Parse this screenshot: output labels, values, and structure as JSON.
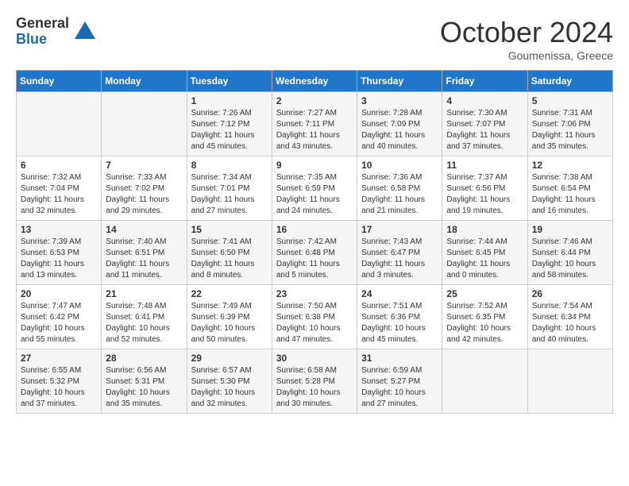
{
  "logo": {
    "general": "General",
    "blue": "Blue"
  },
  "title": "October 2024",
  "location": "Goumenissa, Greece",
  "days_of_week": [
    "Sunday",
    "Monday",
    "Tuesday",
    "Wednesday",
    "Thursday",
    "Friday",
    "Saturday"
  ],
  "weeks": [
    [
      {
        "day": "",
        "info": ""
      },
      {
        "day": "",
        "info": ""
      },
      {
        "day": "1",
        "info": "Sunrise: 7:26 AM\nSunset: 7:12 PM\nDaylight: 11 hours and 45 minutes."
      },
      {
        "day": "2",
        "info": "Sunrise: 7:27 AM\nSunset: 7:11 PM\nDaylight: 11 hours and 43 minutes."
      },
      {
        "day": "3",
        "info": "Sunrise: 7:28 AM\nSunset: 7:09 PM\nDaylight: 11 hours and 40 minutes."
      },
      {
        "day": "4",
        "info": "Sunrise: 7:30 AM\nSunset: 7:07 PM\nDaylight: 11 hours and 37 minutes."
      },
      {
        "day": "5",
        "info": "Sunrise: 7:31 AM\nSunset: 7:06 PM\nDaylight: 11 hours and 35 minutes."
      }
    ],
    [
      {
        "day": "6",
        "info": "Sunrise: 7:32 AM\nSunset: 7:04 PM\nDaylight: 11 hours and 32 minutes."
      },
      {
        "day": "7",
        "info": "Sunrise: 7:33 AM\nSunset: 7:02 PM\nDaylight: 11 hours and 29 minutes."
      },
      {
        "day": "8",
        "info": "Sunrise: 7:34 AM\nSunset: 7:01 PM\nDaylight: 11 hours and 27 minutes."
      },
      {
        "day": "9",
        "info": "Sunrise: 7:35 AM\nSunset: 6:59 PM\nDaylight: 11 hours and 24 minutes."
      },
      {
        "day": "10",
        "info": "Sunrise: 7:36 AM\nSunset: 6:58 PM\nDaylight: 11 hours and 21 minutes."
      },
      {
        "day": "11",
        "info": "Sunrise: 7:37 AM\nSunset: 6:56 PM\nDaylight: 11 hours and 19 minutes."
      },
      {
        "day": "12",
        "info": "Sunrise: 7:38 AM\nSunset: 6:54 PM\nDaylight: 11 hours and 16 minutes."
      }
    ],
    [
      {
        "day": "13",
        "info": "Sunrise: 7:39 AM\nSunset: 6:53 PM\nDaylight: 11 hours and 13 minutes."
      },
      {
        "day": "14",
        "info": "Sunrise: 7:40 AM\nSunset: 6:51 PM\nDaylight: 11 hours and 11 minutes."
      },
      {
        "day": "15",
        "info": "Sunrise: 7:41 AM\nSunset: 6:50 PM\nDaylight: 11 hours and 8 minutes."
      },
      {
        "day": "16",
        "info": "Sunrise: 7:42 AM\nSunset: 6:48 PM\nDaylight: 11 hours and 5 minutes."
      },
      {
        "day": "17",
        "info": "Sunrise: 7:43 AM\nSunset: 6:47 PM\nDaylight: 11 hours and 3 minutes."
      },
      {
        "day": "18",
        "info": "Sunrise: 7:44 AM\nSunset: 6:45 PM\nDaylight: 11 hours and 0 minutes."
      },
      {
        "day": "19",
        "info": "Sunrise: 7:46 AM\nSunset: 6:44 PM\nDaylight: 10 hours and 58 minutes."
      }
    ],
    [
      {
        "day": "20",
        "info": "Sunrise: 7:47 AM\nSunset: 6:42 PM\nDaylight: 10 hours and 55 minutes."
      },
      {
        "day": "21",
        "info": "Sunrise: 7:48 AM\nSunset: 6:41 PM\nDaylight: 10 hours and 52 minutes."
      },
      {
        "day": "22",
        "info": "Sunrise: 7:49 AM\nSunset: 6:39 PM\nDaylight: 10 hours and 50 minutes."
      },
      {
        "day": "23",
        "info": "Sunrise: 7:50 AM\nSunset: 6:38 PM\nDaylight: 10 hours and 47 minutes."
      },
      {
        "day": "24",
        "info": "Sunrise: 7:51 AM\nSunset: 6:36 PM\nDaylight: 10 hours and 45 minutes."
      },
      {
        "day": "25",
        "info": "Sunrise: 7:52 AM\nSunset: 6:35 PM\nDaylight: 10 hours and 42 minutes."
      },
      {
        "day": "26",
        "info": "Sunrise: 7:54 AM\nSunset: 6:34 PM\nDaylight: 10 hours and 40 minutes."
      }
    ],
    [
      {
        "day": "27",
        "info": "Sunrise: 6:55 AM\nSunset: 5:32 PM\nDaylight: 10 hours and 37 minutes."
      },
      {
        "day": "28",
        "info": "Sunrise: 6:56 AM\nSunset: 5:31 PM\nDaylight: 10 hours and 35 minutes."
      },
      {
        "day": "29",
        "info": "Sunrise: 6:57 AM\nSunset: 5:30 PM\nDaylight: 10 hours and 32 minutes."
      },
      {
        "day": "30",
        "info": "Sunrise: 6:58 AM\nSunset: 5:28 PM\nDaylight: 10 hours and 30 minutes."
      },
      {
        "day": "31",
        "info": "Sunrise: 6:59 AM\nSunset: 5:27 PM\nDaylight: 10 hours and 27 minutes."
      },
      {
        "day": "",
        "info": ""
      },
      {
        "day": "",
        "info": ""
      }
    ]
  ]
}
